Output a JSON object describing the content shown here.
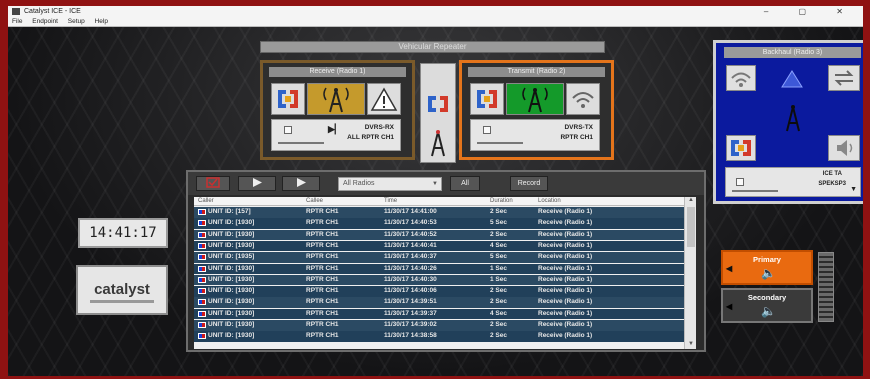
{
  "window": {
    "title": "Catalyst ICE - ICE",
    "controls": "– ▢ ✕"
  },
  "menu": [
    "File",
    "Endpoint",
    "Setup",
    "Help"
  ],
  "colors": {
    "frame": "#8f1212",
    "receive_border": "#7a5a2a",
    "transmit_border": "#e4741b",
    "backhaul_bg": "#0b1a9e",
    "primary": "#e96a10"
  },
  "repeater": {
    "title": "Vehicular Repeater",
    "receive": {
      "title": "Receive (Radio 1)",
      "channel_line1": "DVRS-RX",
      "channel_line2": "ALL RPTR CH1",
      "icons": [
        "routing-icon",
        "tower-icon",
        "warning-icon"
      ]
    },
    "transmit": {
      "title": "Transmit (Radio 2)",
      "channel_line1": "DVRS-TX",
      "channel_line2": "RPTR CH1",
      "icons": [
        "routing-icon",
        "tower-icon",
        "wifi-icon"
      ]
    },
    "link_icons": [
      "routing-icon",
      "tower-icon"
    ]
  },
  "backhaul": {
    "title": "Backhaul (Radio 3)",
    "channel_line1": "ICE TA",
    "channel_line2": "SPEKSP3",
    "icons": [
      "wifi-icon",
      "warning-icon",
      "swap-icon",
      "tower-icon",
      "routing-icon",
      "speaker-icon"
    ]
  },
  "clock": "14:41:17",
  "logo": "catalyst",
  "log": {
    "toolbar": {
      "checkbox_icon": "check-icon",
      "play_icon": "play-icon",
      "play2_icon": "play-icon",
      "filter_value": "All Radios",
      "all_label": "All",
      "record_label": "Record"
    },
    "columns": [
      "Caller",
      "Callee",
      "Time",
      "Duration",
      "Location"
    ],
    "rows": [
      [
        "UNIT ID: [157]",
        "RPTR CH1",
        "11/30/17 14:41:00",
        "2 Sec",
        "Receive (Radio 1)"
      ],
      [
        "UNIT ID: [1930]",
        "RPTR CH1",
        "11/30/17 14:40:53",
        "5 Sec",
        "Receive (Radio 1)"
      ],
      [
        "UNIT ID: [1930]",
        "RPTR CH1",
        "11/30/17 14:40:52",
        "2 Sec",
        "Receive (Radio 1)"
      ],
      [
        "UNIT ID: [1930]",
        "RPTR CH1",
        "11/30/17 14:40:41",
        "4 Sec",
        "Receive (Radio 1)"
      ],
      [
        "UNIT ID: [1935]",
        "RPTR CH1",
        "11/30/17 14:40:37",
        "5 Sec",
        "Receive (Radio 1)"
      ],
      [
        "UNIT ID: [1930]",
        "RPTR CH1",
        "11/30/17 14:40:26",
        "1 Sec",
        "Receive (Radio 1)"
      ],
      [
        "UNIT ID: [1930]",
        "RPTR CH1",
        "11/30/17 14:40:30",
        "1 Sec",
        "Receive (Radio 1)"
      ],
      [
        "UNIT ID: [1930]",
        "RPTR CH1",
        "11/30/17 14:40:06",
        "2 Sec",
        "Receive (Radio 1)"
      ],
      [
        "UNIT ID: [1930]",
        "RPTR CH1",
        "11/30/17 14:39:51",
        "2 Sec",
        "Receive (Radio 1)"
      ],
      [
        "UNIT ID: [1930]",
        "RPTR CH1",
        "11/30/17 14:39:37",
        "4 Sec",
        "Receive (Radio 1)"
      ],
      [
        "UNIT ID: [1930]",
        "RPTR CH1",
        "11/30/17 14:39:02",
        "2 Sec",
        "Receive (Radio 1)"
      ],
      [
        "UNIT ID: [1930]",
        "RPTR CH1",
        "11/30/17 14:38:58",
        "2 Sec",
        "Receive (Radio 1)"
      ]
    ]
  },
  "routing": {
    "primary_label": "Primary",
    "secondary_label": "Secondary"
  }
}
